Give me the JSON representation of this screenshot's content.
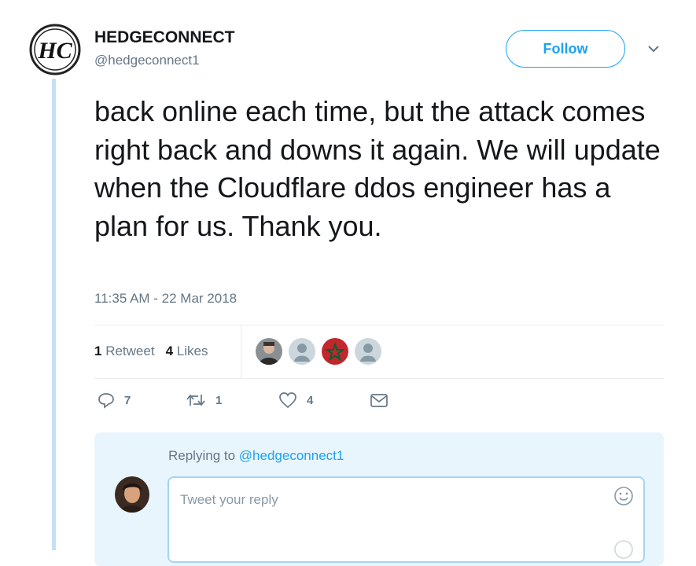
{
  "author": {
    "display_name": "HEDGECONNECT",
    "handle": "@hedgeconnect1",
    "logo_text": "HC"
  },
  "follow_label": "Follow",
  "tweet": {
    "text": "back online each time, but the attack comes right back and downs it again. We will update when the Cloudflare ddos engineer has a plan for us. Thank you.",
    "timestamp": "11:35 AM - 22 Mar 2018"
  },
  "stats": {
    "retweets_count": "1",
    "retweets_label": "Retweet",
    "likes_count": "4",
    "likes_label": "Likes"
  },
  "actions": {
    "reply_count": "7",
    "retweet_count": "1",
    "like_count": "4"
  },
  "reply": {
    "replying_prefix": "Replying to",
    "replying_handle": "@hedgeconnect1",
    "placeholder": "Tweet your reply"
  },
  "icons": [
    "caret-down-icon",
    "reply-icon",
    "retweet-icon",
    "heart-icon",
    "envelope-icon",
    "emoji-icon"
  ],
  "colors": {
    "accent": "#1da1f2",
    "muted": "#657786",
    "thread": "#c4e0f5",
    "reply_bg": "#e8f5fd"
  }
}
